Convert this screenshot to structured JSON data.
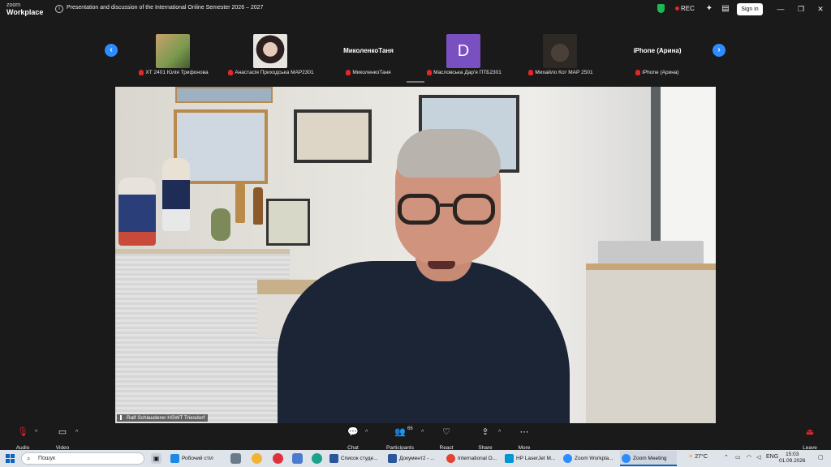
{
  "app": {
    "logo_line1": "zoom",
    "logo_line2": "Workplace",
    "meeting_title": "Presentation and discussion of the International Online Semester 2026 – 2027",
    "rec_label": "REC",
    "sign_in_label": "Sign in"
  },
  "participants": [
    {
      "label": "ХТ 2401 Юлія Трифонова",
      "thumb_color": "#9bb06a",
      "type": "photo"
    },
    {
      "label": "Анастасія Приходська МАР2301",
      "thumb_color": "#d8cfc8",
      "type": "photo"
    },
    {
      "name": "МиколенкоТаня",
      "label": "МиколенкоТаня",
      "type": "name"
    },
    {
      "label": "Масловська Дар'я ПТБ2301",
      "initial": "D",
      "thumb_color": "#7a4fc0",
      "type": "initial"
    },
    {
      "label": "Михайло Кот МАР 2501",
      "thumb_color": "#3a332c",
      "type": "photo"
    },
    {
      "name": "iPhone (Арина)",
      "label": "iPhone (Арина)",
      "type": "name"
    }
  ],
  "speaker": {
    "name": "Ralf Schlauderer HSWT Triesdorf"
  },
  "controls": {
    "audio": "Audio",
    "video": "Video",
    "chat": "Chat",
    "participants": "Participants",
    "participants_count": "66",
    "react": "React",
    "share": "Share",
    "more": "More",
    "leave": "Leave"
  },
  "taskbar": {
    "search_placeholder": "Пошук",
    "apps": [
      {
        "label": "Робочий стіл",
        "color": "#1e88e5"
      },
      {
        "label": "Список студе...",
        "color": "#2b579a"
      },
      {
        "label": "Документ2 - ...",
        "color": "#2b579a"
      },
      {
        "label": "International O...",
        "color": "#e34234"
      },
      {
        "label": "HP LaserJet M...",
        "color": "#0096d6"
      },
      {
        "label": "Zoom Workpla...",
        "color": "#2d8cff"
      },
      {
        "label": "Zoom Meeting",
        "color": "#2d8cff"
      }
    ],
    "temperature": "27°C",
    "language": "ENG",
    "time": "15:03",
    "date": "01.09.2026"
  }
}
